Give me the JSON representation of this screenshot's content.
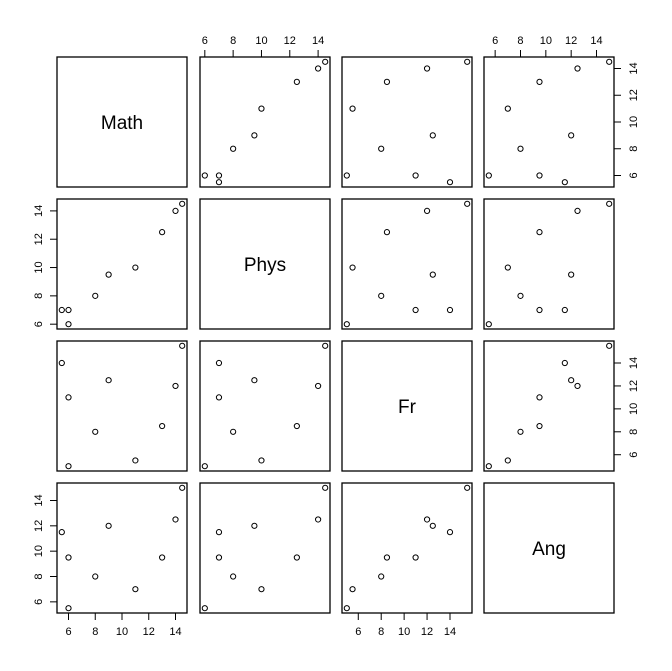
{
  "chart_data": {
    "type": "scatter",
    "subtype": "scatterplot-matrix",
    "title": "",
    "variables": [
      "Math",
      "Phys",
      "Fr",
      "Ang"
    ],
    "observations": {
      "Math": [
        5.5,
        6,
        6,
        8,
        9,
        11,
        13,
        14,
        14.5
      ],
      "Phys": [
        7,
        7,
        6,
        8,
        9.5,
        10,
        12.5,
        14,
        14.5
      ],
      "Fr": [
        14,
        11,
        5,
        8,
        12.5,
        5.5,
        8.5,
        12,
        15.5
      ],
      "Ang": [
        11.5,
        9.5,
        5.5,
        8,
        12,
        7,
        9.5,
        12.5,
        15
      ]
    },
    "ticks": {
      "Math": [
        6,
        8,
        10,
        12,
        14
      ],
      "Phys": [
        6,
        8,
        10,
        12,
        14
      ],
      "Fr": [
        6,
        8,
        10,
        12,
        14
      ],
      "Ang": [
        6,
        8,
        10,
        12,
        14
      ]
    },
    "axis_placement": {
      "top_columns": [
        "Phys",
        "Ang"
      ],
      "bottom_columns": [
        "Math",
        "Fr"
      ],
      "left_rows": [
        "Phys",
        "Ang"
      ],
      "right_rows": [
        "Math",
        "Fr"
      ]
    },
    "grid": false,
    "marker": "open-circle",
    "legend": "none"
  }
}
